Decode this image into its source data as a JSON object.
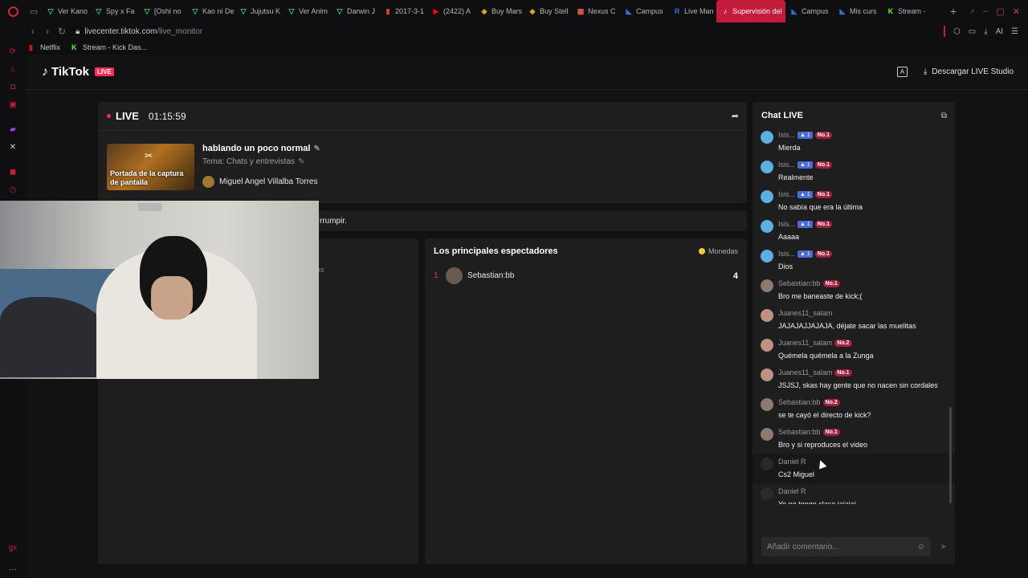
{
  "browser": {
    "tabs": [
      {
        "label": "Ver Kano",
        "fav": "▽",
        "color": "#3ec46d"
      },
      {
        "label": "Spy x Fa",
        "fav": "▽",
        "color": "#3ec46d"
      },
      {
        "label": "[Oshi no",
        "fav": "▽",
        "color": "#3ec46d"
      },
      {
        "label": "Kao ni De",
        "fav": "▽",
        "color": "#3ec46d"
      },
      {
        "label": "Jujutsu K",
        "fav": "▽",
        "color": "#3ec46d"
      },
      {
        "label": "Ver Anim",
        "fav": "▽",
        "color": "#3ec46d"
      },
      {
        "label": "Darwin J",
        "fav": "▽",
        "color": "#3ec46d"
      },
      {
        "label": "2017-3-1",
        "fav": "▮",
        "color": "#e04020"
      },
      {
        "label": "(2422) A",
        "fav": "▶",
        "color": "#ff0000"
      },
      {
        "label": "Buy Mars",
        "fav": "◆",
        "color": "#e0a020"
      },
      {
        "label": "Buy Stell",
        "fav": "◆",
        "color": "#e0a020"
      },
      {
        "label": "Nexus C",
        "fav": "▦",
        "color": "#e06040"
      },
      {
        "label": "Campus",
        "fav": "◣",
        "color": "#3070d0"
      },
      {
        "label": "Live Man",
        "fav": "R",
        "color": "#3a6ad8"
      },
      {
        "label": "Supervisión del",
        "fav": "♪",
        "color": "#ffffff",
        "active": true
      },
      {
        "label": "Campus",
        "fav": "◣",
        "color": "#3070d0"
      },
      {
        "label": "Mis curs",
        "fav": "◣",
        "color": "#3070d0"
      },
      {
        "label": "Stream -",
        "fav": "K",
        "color": "#53fc18"
      }
    ],
    "url_host": "livecenter.tiktok.com",
    "url_path": "/live_monitor",
    "ai_label": "AI",
    "bookmarks": [
      {
        "label": "Netflix",
        "fav": "▮",
        "color": "#e50914"
      },
      {
        "label": "Stream - Kick Das...",
        "fav": "K",
        "color": "#53fc18"
      }
    ]
  },
  "header": {
    "logo_text": "TikTok",
    "live_badge": "LIVE",
    "download_label": "Descargar LIVE Studio"
  },
  "live": {
    "label": "LIVE",
    "timer": "01:15:59",
    "thumb_caption": "Portada de la captura de pantalla",
    "title": "hablando un poco normal",
    "topic": "Tema: Chats y entrevistas",
    "host": "Miguel Angel Villalba Torres",
    "notice": "rrumpir.",
    "ghost_text": "es"
  },
  "viewers": {
    "title": "Los principales espectadores",
    "coins_label": "Monedas",
    "rows": [
      {
        "rank": "1",
        "name": "Sebastian:bb",
        "count": "4"
      }
    ]
  },
  "chat": {
    "title": "Chat LIVE",
    "placeholder": "Añadir comentario...",
    "messages": [
      {
        "name": "Isis...",
        "lvl": "1",
        "no": "No.1",
        "text": "Mierda",
        "av": "#5ab0e0"
      },
      {
        "name": "Isis...",
        "lvl": "1",
        "no": "No.1",
        "text": "Realmente",
        "av": "#5ab0e0"
      },
      {
        "name": "Isis...",
        "lvl": "1",
        "no": "No.1",
        "text": "No sabía que era la última",
        "av": "#5ab0e0"
      },
      {
        "name": "Isis...",
        "lvl": "1",
        "no": "No.1",
        "text": "Aaaaa",
        "av": "#5ab0e0"
      },
      {
        "name": "Isis...",
        "lvl": "1",
        "no": "No.1",
        "text": "Dios",
        "av": "#5ab0e0"
      },
      {
        "name": "Sebastian:bb",
        "lvl": "",
        "no": "No.1",
        "text": "Bro me baneaste de kick;(",
        "av": "#8a7a70"
      },
      {
        "name": "Juanes11_salam",
        "lvl": "",
        "no": "",
        "text": "JAJAJAJJAJAJA, déjate sacar las muelitas",
        "av": "#c09080"
      },
      {
        "name": "Juanes11_salam",
        "lvl": "",
        "no": "No.2",
        "text": "Quémela quémela a la Zunga",
        "av": "#c09080"
      },
      {
        "name": "Juanes11_salam",
        "lvl": "",
        "no": "No.1",
        "text": "JSJSJ, skas hay gente que no nacen sin cordales",
        "av": "#c09080"
      },
      {
        "name": "Sebastian:bb",
        "lvl": "",
        "no": "No.2",
        "text": "se te cayó el directo de kick?",
        "av": "#8a7a70"
      },
      {
        "name": "Sebastian:bb",
        "lvl": "",
        "no": "No.1",
        "text": "Bro y si reproduces el video",
        "av": "#8a7a70"
      },
      {
        "name": "Daniel R",
        "lvl": "",
        "no": "",
        "text": "Cs2 Miguel",
        "av": "#2a2a2a",
        "hover": true
      },
      {
        "name": "Daniel R",
        "lvl": "",
        "no": "",
        "text": "Yo no tengo clase jajajaj",
        "av": "#2a2a2a"
      }
    ]
  }
}
